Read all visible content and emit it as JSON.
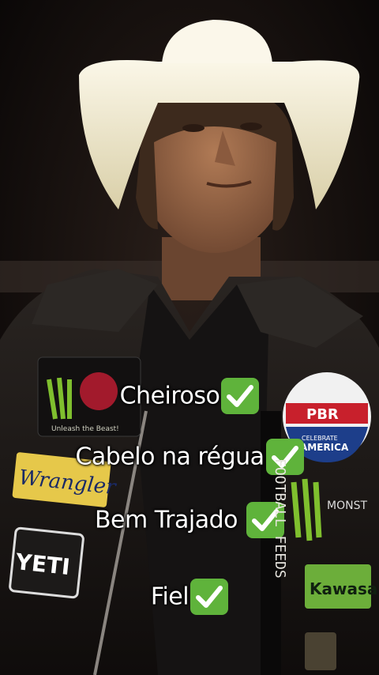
{
  "captions": [
    {
      "text": "Cheiroso",
      "icon": "check-mark-icon"
    },
    {
      "text": "Cabelo na régua",
      "icon": "check-mark-icon"
    },
    {
      "text": "Bem Trajado ",
      "icon": "check-mark-icon"
    },
    {
      "text": "Fiel",
      "icon": "check-mark-icon"
    }
  ],
  "patches": {
    "wrangler": "Wrangler",
    "yeti": "YETI",
    "pbr": "PBR",
    "celebrate": "CELEBRATE",
    "america": "AMERICA",
    "kawasaki": "Kawasa",
    "monster_text": "MONST",
    "unleash": "Unleash the Beast!",
    "sleeve_text": "FOOTBALL FEEDS"
  },
  "colors": {
    "background": "#0b0808",
    "hat": "#f2ecd6",
    "jacket": "#1b1816",
    "check_green": "#5fb33b",
    "monster_green": "#7fbf2e",
    "wrangler_yellow": "#e6c84a",
    "pbr_red": "#c8202c",
    "pbr_blue": "#1d3e8a"
  }
}
